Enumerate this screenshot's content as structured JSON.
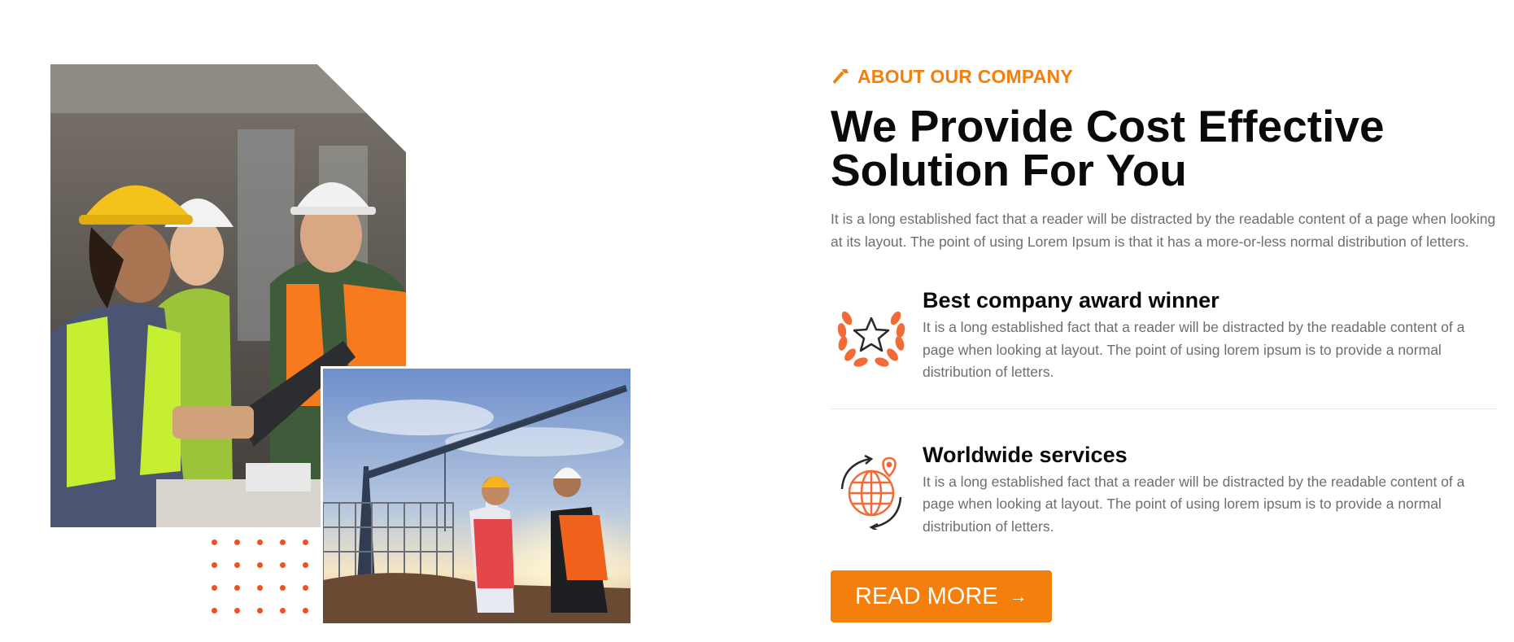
{
  "about": {
    "eyebrow": "ABOUT OUR COMPANY",
    "eyebrow_icon": "hammer-icon",
    "heading": "We Provide Cost Effective Solution For You",
    "intro": "It is a long established fact that a reader will be distracted by the readable content of a page when looking at its layout. The point of using Lorem Ipsum is that it has a more-or-less normal distribution of letters."
  },
  "features": [
    {
      "icon": "award-laurel-star-icon",
      "title": "Best company award winner",
      "description": "It is a long established fact that a reader will be distracted by the readable content of a page when looking at layout. The point of using lorem ipsum is to provide a normal distribution of letters."
    },
    {
      "icon": "globe-location-icon",
      "title": "Worldwide services",
      "description": "It is a long established fact that a reader will be distracted by the readable content of a page when looking at layout. The point of using lorem ipsum is to provide a normal distribution of letters."
    }
  ],
  "cta": {
    "label": "READ MORE",
    "arrow": "→"
  },
  "images": {
    "main": "engineers-with-tablet-photo",
    "secondary": "construction-site-crane-photo"
  },
  "colors": {
    "accent": "#f47f0c",
    "dots": "#f0521f",
    "icon_orange": "#f26a36",
    "heading": "#0a0a0a",
    "body_text": "#6e6e6e"
  }
}
